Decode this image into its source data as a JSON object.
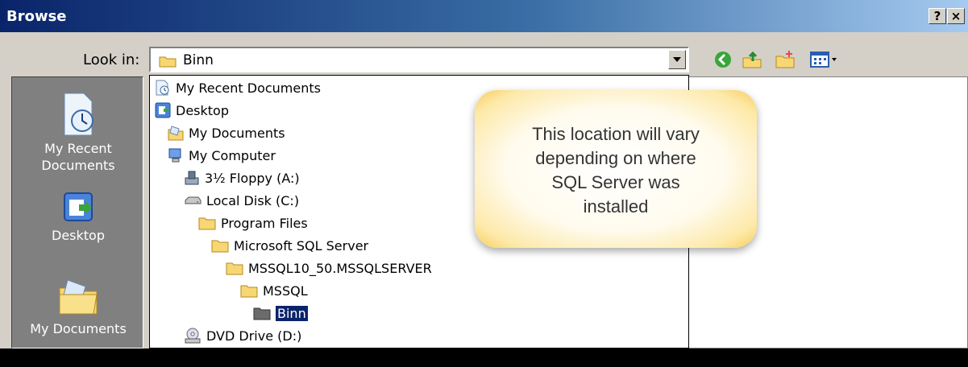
{
  "window": {
    "title": "Browse",
    "help_button": "?",
    "close_button": "×"
  },
  "lookin": {
    "label": "Look in:",
    "current": "Binn"
  },
  "places": [
    {
      "label_line1": "My Recent",
      "label_line2": "Documents",
      "icon": "recent-documents-icon"
    },
    {
      "label_line1": "Desktop",
      "label_line2": "",
      "icon": "desktop-icon"
    },
    {
      "label_line1": "My Documents",
      "label_line2": "",
      "icon": "my-documents-icon"
    }
  ],
  "dropdown_items": [
    {
      "label": "My Recent Documents",
      "icon": "recent-documents-icon",
      "level": 0
    },
    {
      "label": "Desktop",
      "icon": "desktop-icon",
      "level": 0
    },
    {
      "label": "My Documents",
      "icon": "my-documents-icon",
      "level": 1
    },
    {
      "label": "My Computer",
      "icon": "my-computer-icon",
      "level": 1
    },
    {
      "label": "3½ Floppy (A:)",
      "icon": "floppy-icon",
      "level": 2
    },
    {
      "label": "Local Disk (C:)",
      "icon": "local-disk-icon",
      "level": 2
    },
    {
      "label": "Program Files",
      "icon": "folder-icon",
      "level": 3
    },
    {
      "label": "Microsoft SQL Server",
      "icon": "folder-icon",
      "level": 4
    },
    {
      "label": "MSSQL10_50.MSSQLSERVER",
      "icon": "folder-icon",
      "level": 5
    },
    {
      "label": "MSSQL",
      "icon": "folder-icon",
      "level": 6
    },
    {
      "label": "Binn",
      "icon": "open-folder-icon",
      "level": 7,
      "selected": true
    },
    {
      "label": "DVD Drive (D:)",
      "icon": "dvd-drive-icon",
      "level": 2
    }
  ],
  "toolbar": [
    "back-icon",
    "up-folder-icon",
    "new-folder-icon",
    "view-menu-icon"
  ],
  "callout": {
    "line1": "This location will vary",
    "line2": "depending on where",
    "line3": "SQL Server was",
    "line4": "installed"
  }
}
